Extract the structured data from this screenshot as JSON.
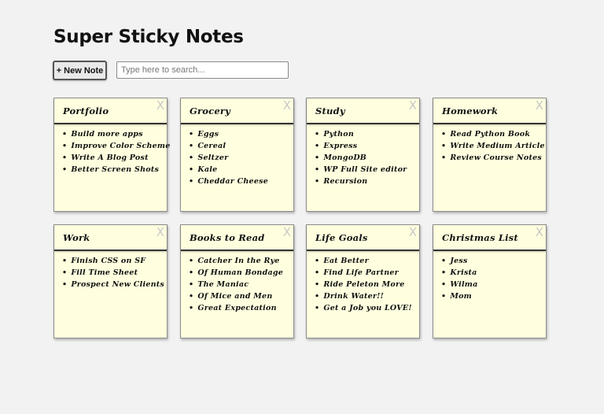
{
  "app": {
    "title": "Super Sticky Notes"
  },
  "toolbar": {
    "new_note_label": "+ New Note",
    "search_placeholder": "Type here to search...",
    "search_value": ""
  },
  "notes": [
    {
      "title": "Portfolio",
      "close_label": "X",
      "items": [
        "Build more apps",
        "Improve Color Scheme",
        "Write A Blog Post",
        "Better Screen Shots"
      ]
    },
    {
      "title": "Grocery",
      "close_label": "X",
      "items": [
        "Eggs",
        "Cereal",
        "Seltzer",
        "Kale",
        "Cheddar Cheese"
      ]
    },
    {
      "title": "Study",
      "close_label": "X",
      "items": [
        "Python",
        "Express",
        "MongoDB",
        "WP Full Site editor",
        "Recursion"
      ]
    },
    {
      "title": "Homework",
      "close_label": "X",
      "items": [
        "Read Python Book",
        "Write Medium Article",
        "Review Course Notes"
      ]
    },
    {
      "title": "Work",
      "close_label": "X",
      "items": [
        "Finish CSS on SF",
        "Fill Time Sheet",
        "Prospect New Clients"
      ]
    },
    {
      "title": "Books to Read",
      "close_label": "X",
      "items": [
        "Catcher In the Rye",
        "Of Human Bondage",
        "The Maniac",
        "Of Mice and Men",
        "Great Expectation"
      ]
    },
    {
      "title": "Life Goals",
      "close_label": "X",
      "items": [
        "Eat Better",
        "Find Life Partner",
        "Ride Peleton More",
        "Drink Water!!",
        "Get a Job you LOVE!"
      ]
    },
    {
      "title": "Christmas List",
      "close_label": "X",
      "items": [
        "Jess",
        "Krista",
        "Wilma",
        "Mom"
      ]
    }
  ],
  "colors": {
    "background": "#f2f2f2",
    "note_background": "#ffffdf",
    "note_border": "#8f8f8f",
    "close_icon": "#c8c8c8"
  }
}
